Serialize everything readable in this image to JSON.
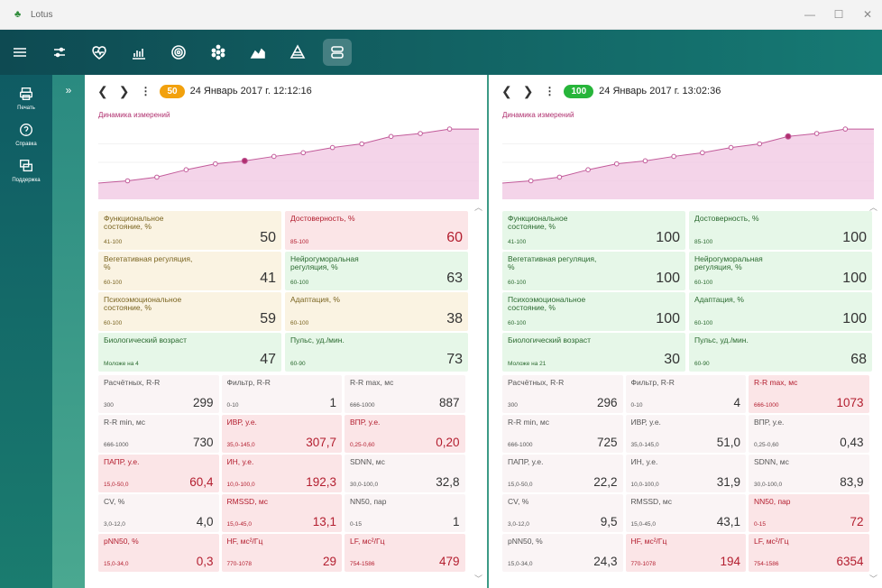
{
  "app": {
    "title": "Lotus"
  },
  "sidebar": {
    "items": [
      {
        "label": "Печать",
        "icon": "printer-icon"
      },
      {
        "label": "Справка",
        "icon": "help-icon"
      },
      {
        "label": "Поддержка",
        "icon": "support-icon"
      }
    ]
  },
  "panels": [
    {
      "badge": "50",
      "badge_color": "#f2a10d",
      "datetime": "24 Январь 2017 г. 12:12:16",
      "chart_title": "Динамика измерений",
      "chart_points": [
        22,
        25,
        30,
        40,
        48,
        52,
        58,
        63,
        70,
        75,
        85,
        89,
        95,
        95
      ],
      "highlight_index": 5,
      "tiles": [
        {
          "name": "Функциональное состояние, %",
          "range": "41-100",
          "value": "50",
          "color": "yellow"
        },
        {
          "name": "Достоверность, %",
          "range": "85-100",
          "value": "60",
          "color": "red"
        },
        {
          "name": "Вегетативная регуляция, %",
          "range": "60-100",
          "value": "41",
          "color": "yellow"
        },
        {
          "name": "Нейрогуморальная регуляция, %",
          "range": "60-100",
          "value": "63",
          "color": "green"
        },
        {
          "name": "Психоэмоциональное состояние, %",
          "range": "60-100",
          "value": "59",
          "color": "yellow"
        },
        {
          "name": "Адаптация, %",
          "range": "60-100",
          "value": "38",
          "color": "yellow"
        },
        {
          "name": "Биологический возраст",
          "range": "Моложе на 4",
          "value": "47",
          "color": "green"
        },
        {
          "name": "Пульс, уд./мин.",
          "range": "60-90",
          "value": "73",
          "color": "green"
        }
      ],
      "small": [
        {
          "name": "Расчётных, R-R",
          "range": "300",
          "value": "299",
          "color": "grey"
        },
        {
          "name": "Фильтр, R-R",
          "range": "0-10",
          "value": "1",
          "color": "grey"
        },
        {
          "name": "R-R max, мс",
          "range": "666-1000",
          "value": "887",
          "color": "grey"
        },
        {
          "name": "R-R min, мс",
          "range": "666-1000",
          "value": "730",
          "color": "grey"
        },
        {
          "name": "ИВР, у.е.",
          "range": "35,0-145,0",
          "value": "307,7",
          "color": "red"
        },
        {
          "name": "ВПР, у.е.",
          "range": "0,25-0,60",
          "value": "0,20",
          "color": "red"
        },
        {
          "name": "ПАПР, у.е.",
          "range": "15,0-50,0",
          "value": "60,4",
          "color": "red"
        },
        {
          "name": "ИН, у.е.",
          "range": "10,0-100,0",
          "value": "192,3",
          "color": "red"
        },
        {
          "name": "SDNN, мс",
          "range": "30,0-100,0",
          "value": "32,8",
          "color": "grey"
        },
        {
          "name": "CV, %",
          "range": "3,0-12,0",
          "value": "4,0",
          "color": "grey"
        },
        {
          "name": "RMSSD, мс",
          "range": "15,0-45,0",
          "value": "13,1",
          "color": "red"
        },
        {
          "name": "NN50, пар",
          "range": "0-15",
          "value": "1",
          "color": "grey"
        },
        {
          "name": "pNN50, %",
          "range": "15,0-34,0",
          "value": "0,3",
          "color": "red"
        },
        {
          "name": "HF, мс²/Гц",
          "range": "770-1078",
          "value": "29",
          "color": "red"
        },
        {
          "name": "LF, мс²/Гц",
          "range": "754-1586",
          "value": "479",
          "color": "red"
        }
      ]
    },
    {
      "badge": "100",
      "badge_color": "#27b53a",
      "datetime": "24 Январь 2017 г. 13:02:36",
      "chart_title": "Динамика измерений",
      "chart_points": [
        22,
        25,
        30,
        40,
        48,
        52,
        58,
        63,
        70,
        75,
        85,
        89,
        95,
        95
      ],
      "highlight_index": 10,
      "tiles": [
        {
          "name": "Функциональное состояние, %",
          "range": "41-100",
          "value": "100",
          "color": "green"
        },
        {
          "name": "Достоверность, %",
          "range": "85-100",
          "value": "100",
          "color": "green"
        },
        {
          "name": "Вегетативная регуляция, %",
          "range": "60-100",
          "value": "100",
          "color": "green"
        },
        {
          "name": "Нейрогуморальная регуляция, %",
          "range": "60-100",
          "value": "100",
          "color": "green"
        },
        {
          "name": "Психоэмоциональное состояние, %",
          "range": "60-100",
          "value": "100",
          "color": "green"
        },
        {
          "name": "Адаптация, %",
          "range": "60-100",
          "value": "100",
          "color": "green"
        },
        {
          "name": "Биологический возраст",
          "range": "Моложе на 21",
          "value": "30",
          "color": "green"
        },
        {
          "name": "Пульс, уд./мин.",
          "range": "60-90",
          "value": "68",
          "color": "green"
        }
      ],
      "small": [
        {
          "name": "Расчётных, R-R",
          "range": "300",
          "value": "296",
          "color": "grey"
        },
        {
          "name": "Фильтр, R-R",
          "range": "0-10",
          "value": "4",
          "color": "grey"
        },
        {
          "name": "R-R max, мс",
          "range": "666-1000",
          "value": "1073",
          "color": "red"
        },
        {
          "name": "R-R min, мс",
          "range": "666-1000",
          "value": "725",
          "color": "grey"
        },
        {
          "name": "ИВР, у.е.",
          "range": "35,0-145,0",
          "value": "51,0",
          "color": "grey"
        },
        {
          "name": "ВПР, у.е.",
          "range": "0,25-0,60",
          "value": "0,43",
          "color": "grey"
        },
        {
          "name": "ПАПР, у.е.",
          "range": "15,0-50,0",
          "value": "22,2",
          "color": "grey"
        },
        {
          "name": "ИН, у.е.",
          "range": "10,0-100,0",
          "value": "31,9",
          "color": "grey"
        },
        {
          "name": "SDNN, мс",
          "range": "30,0-100,0",
          "value": "83,9",
          "color": "grey"
        },
        {
          "name": "CV, %",
          "range": "3,0-12,0",
          "value": "9,5",
          "color": "grey"
        },
        {
          "name": "RMSSD, мс",
          "range": "15,0-45,0",
          "value": "43,1",
          "color": "grey"
        },
        {
          "name": "NN50, пар",
          "range": "0-15",
          "value": "72",
          "color": "red"
        },
        {
          "name": "pNN50, %",
          "range": "15,0-34,0",
          "value": "24,3",
          "color": "grey"
        },
        {
          "name": "HF, мс²/Гц",
          "range": "770-1078",
          "value": "194",
          "color": "red"
        },
        {
          "name": "LF, мс²/Гц",
          "range": "754-1586",
          "value": "6354",
          "color": "red"
        }
      ]
    }
  ]
}
